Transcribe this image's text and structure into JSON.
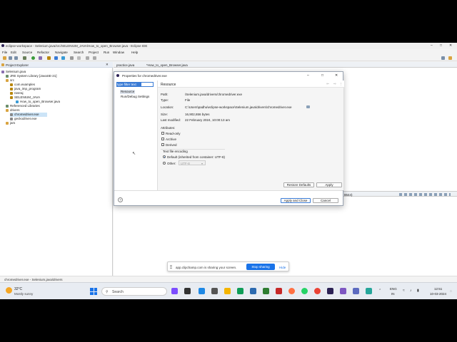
{
  "window": {
    "title": "eclipse-workspace - Selenium.java/src/SELENIUM_JAVA/How_to_open_Browser.java - Eclipse IDE"
  },
  "menu": [
    "File",
    "Edit",
    "Source",
    "Refactor",
    "Navigate",
    "Search",
    "Project",
    "Run",
    "Window",
    "Help"
  ],
  "explorer": {
    "title": "Project Explorer",
    "items": [
      {
        "label": "Selenium.java",
        "indent": 0
      },
      {
        "label": "JRE System Library [JavaSE-21]",
        "indent": 1
      },
      {
        "label": "src",
        "indent": 1
      },
      {
        "label": "com.examples",
        "indent": 2
      },
      {
        "label": "java_imp_program",
        "indent": 2
      },
      {
        "label": "neeraj",
        "indent": 2
      },
      {
        "label": "SELENIUM_JAVA",
        "indent": 2
      },
      {
        "label": "How_to_open_Browser.java",
        "indent": 3
      },
      {
        "label": "Referenced Libraries",
        "indent": 1
      },
      {
        "label": "drivers",
        "indent": 1
      },
      {
        "label": "chromedriver.exe",
        "indent": 2,
        "selected": true
      },
      {
        "label": "geckodriver.exe",
        "indent": 2
      },
      {
        "label": "jars",
        "indent": 1
      }
    ]
  },
  "editor": {
    "tabs": [
      "practice.java",
      "*How_to_open_Browser.java"
    ]
  },
  "console": {
    "fragment": "8644)"
  },
  "dialog": {
    "title": "Properties for chromedriver.exe",
    "filter_text": "type filter text",
    "nav": [
      "Resource",
      "Run/Debug Settings"
    ],
    "section": "Resource",
    "path_label": "Path:",
    "path_value": "/Selenium.java/drivers/chromedriver.exe",
    "type_label": "Type:",
    "type_value": "File",
    "location_label": "Location:",
    "location_value": "C:\\Users\\padhu\\eclipse-workspace\\Selenium.java\\drivers\\chromedriver.exe",
    "size_label": "Size:",
    "size_value": "16,902,656  bytes",
    "modified_label": "Last modified:",
    "modified_value": "22 February 2024, 10:00:13 am",
    "attributes_label": "Attributes:",
    "attributes": [
      "Read-only",
      "Archive",
      "Derived"
    ],
    "encoding_label": "Text file encoding",
    "encoding_default": "Default (inherited from container: UTF-8)",
    "encoding_other": "Other:",
    "encoding_other_value": "UTF-8",
    "restore_defaults": "Restore Defaults",
    "apply": "Apply",
    "apply_close": "Apply and Close",
    "cancel": "Cancel"
  },
  "statusbar": {
    "text": "chromedriver.exe - Selenium.java/drivers"
  },
  "sharebar": {
    "message": "app.clipchamp.com is sharing your screen.",
    "stop": "Stop sharing",
    "hide": "Hide"
  },
  "taskbar": {
    "weather_temp": "32°C",
    "weather_desc": "Mostly sunny",
    "search": "Search",
    "lang_top": "ENG",
    "lang_bottom": "IN",
    "time": "12:51",
    "date": "10-03-2024"
  }
}
